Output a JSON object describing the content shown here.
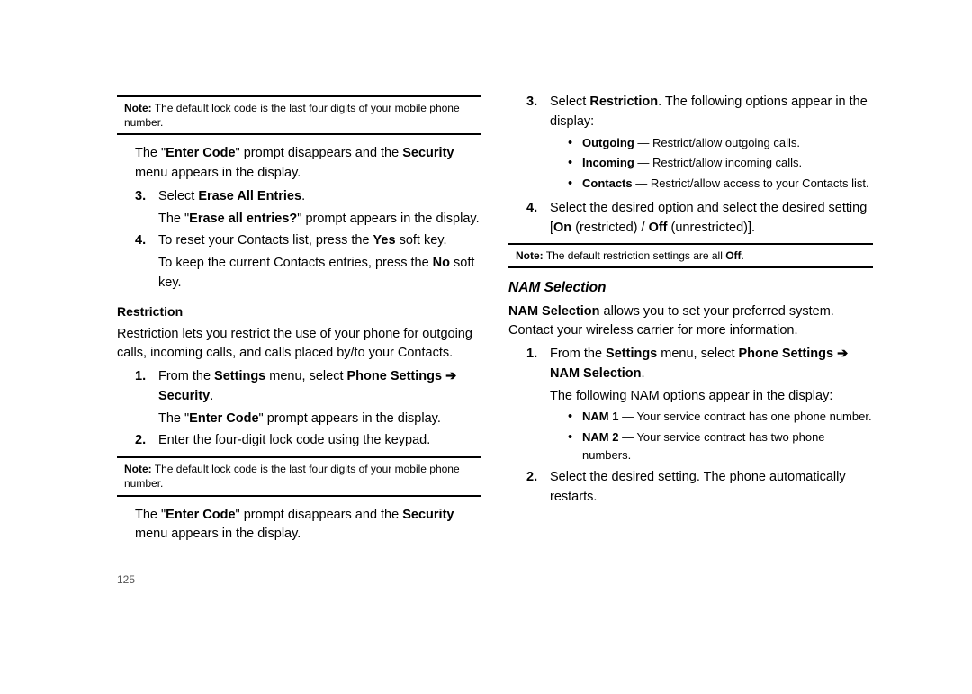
{
  "pageNumber": "125",
  "left": {
    "note1_label": "Note:",
    "note1_text": " The default lock code is the last four digits of your mobile phone number.",
    "para1_a": "The \"",
    "para1_b": "Enter Code",
    "para1_c": "\" prompt disappears and the ",
    "para1_d": "Security",
    "para1_e": " menu appears in the display.",
    "step3_num": "3.",
    "step3_a": "Select ",
    "step3_b": "Erase All Entries",
    "step3_c": ".",
    "step3_sub_a": "The \"",
    "step3_sub_b": "Erase all entries?",
    "step3_sub_c": "\" prompt appears in the display.",
    "step4_num": "4.",
    "step4_a": "To reset your Contacts list, press the ",
    "step4_b": "Yes",
    "step4_c": " soft key.",
    "step4_sub_a": "To keep the current Contacts entries, press the ",
    "step4_sub_b": "No",
    "step4_sub_c": " soft key.",
    "h_restriction": "Restriction",
    "restr_text": "Restriction lets you restrict the use of your phone for outgoing calls, incoming calls, and calls placed by/to your Contacts.",
    "r1_num": "1.",
    "r1_a": "From the ",
    "r1_b": "Settings",
    "r1_c": " menu, select ",
    "r1_d": "Phone Settings ➔ Security",
    "r1_e": ".",
    "r1_sub_a": "The \"",
    "r1_sub_b": "Enter Code",
    "r1_sub_c": "\" prompt appears in the display.",
    "r2_num": "2.",
    "r2_text": "Enter the four-digit lock code using the keypad.",
    "note2_label": "Note:",
    "note2_text": " The default lock code is the last four digits of your mobile phone number.",
    "para2_a": "The \"",
    "para2_b": "Enter Code",
    "para2_c": "\" prompt disappears and the ",
    "para2_d": "Security",
    "para2_e": " menu appears in the display."
  },
  "right": {
    "s3_num": "3.",
    "s3_a": "Select ",
    "s3_b": "Restriction",
    "s3_c": ". The following options appear in the display:",
    "b1_a": "Outgoing",
    "b1_b": " — Restrict/allow outgoing calls.",
    "b2_a": "Incoming",
    "b2_b": " — Restrict/allow incoming calls.",
    "b3_a": "Contacts",
    "b3_b": " — Restrict/allow access to your Contacts list.",
    "s4_num": "4.",
    "s4_a": "Select the desired option and select the desired setting [",
    "s4_b": "On",
    "s4_c": " (restricted) / ",
    "s4_d": "Off",
    "s4_e": " (unrestricted)].",
    "note_label": "Note:",
    "note_text_a": " The default restriction settings are all ",
    "note_text_b": "Off",
    "note_text_c": ".",
    "h_nam": "NAM Selection",
    "nam_a": "NAM Selection",
    "nam_b": " allows you to set your preferred system. Contact your wireless carrier for more information.",
    "n1_num": "1.",
    "n1_a": "From the ",
    "n1_b": "Settings",
    "n1_c": " menu, select ",
    "n1_d": "Phone Settings ➔ NAM Selection",
    "n1_e": ".",
    "n1_sub": "The following NAM options appear in the display:",
    "nb1_a": "NAM 1",
    "nb1_b": " — Your service contract has one phone number.",
    "nb2_a": "NAM 2",
    "nb2_b": " — Your service contract has two phone numbers.",
    "n2_num": "2.",
    "n2_text": "Select the desired setting. The phone automatically restarts."
  }
}
